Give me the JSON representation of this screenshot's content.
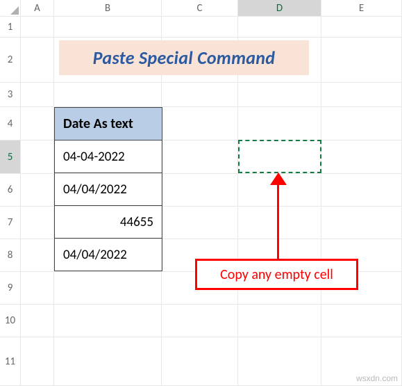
{
  "columns": [
    "A",
    "B",
    "C",
    "D",
    "E"
  ],
  "rows": [
    "1",
    "2",
    "3",
    "4",
    "5",
    "6",
    "7",
    "8",
    "9",
    "10",
    "11"
  ],
  "selected_row": "5",
  "selected_col": "D",
  "title": "Paste Special Command",
  "table": {
    "header": "Date As text",
    "rows": [
      {
        "value": "04-04-2022",
        "align": "left"
      },
      {
        "value": "04/04/2022",
        "align": "left"
      },
      {
        "value": "44655",
        "align": "right"
      },
      {
        "value": "04/04/2022",
        "align": "left"
      }
    ]
  },
  "callout": "Copy any empty cell",
  "watermark": "wsxdn.com"
}
